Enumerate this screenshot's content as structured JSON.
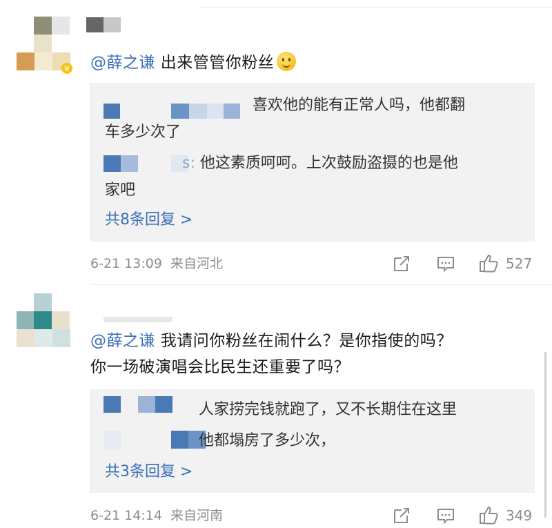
{
  "comments": [
    {
      "mention": "@薛之谦",
      "text": " 出来管管你粉丝",
      "emoji_name": "smile-emoji",
      "replies": [
        {
          "line1": "喜欢他的能有正常人吗，他都翻",
          "line2": "车多少次了"
        },
        {
          "line1_prefix": "s:",
          "line1": " 他这素质呵呵。上次鼓励盗摄的也是他",
          "line2": "家吧"
        }
      ],
      "more_replies": "共8条回复 >",
      "date": "6-21 13:09",
      "location": "来自河北",
      "likes": "527"
    },
    {
      "mention": "@薛之谦",
      "text": " 我请问你粉丝在闹什么？是你指使的吗？",
      "text_line2": "你一场破演唱会比民生还重要了吗？",
      "replies": [
        {
          "line1": "人家捞完钱就跑了，又不长期住在这里"
        },
        {
          "line1": "他都塌房了多少次，"
        }
      ],
      "more_replies": "共3条回复 >",
      "date": "6-21 14:14",
      "location": "来自河南",
      "likes": "349"
    }
  ],
  "icons": {
    "share": "share-icon",
    "comment": "comment-icon",
    "like": "thumbs-up-icon",
    "vip": "vip-badge-icon"
  },
  "colors": {
    "mention": "#3b6fb6",
    "reply_bg": "#f2f2f2",
    "meta": "#8c8c8c"
  }
}
